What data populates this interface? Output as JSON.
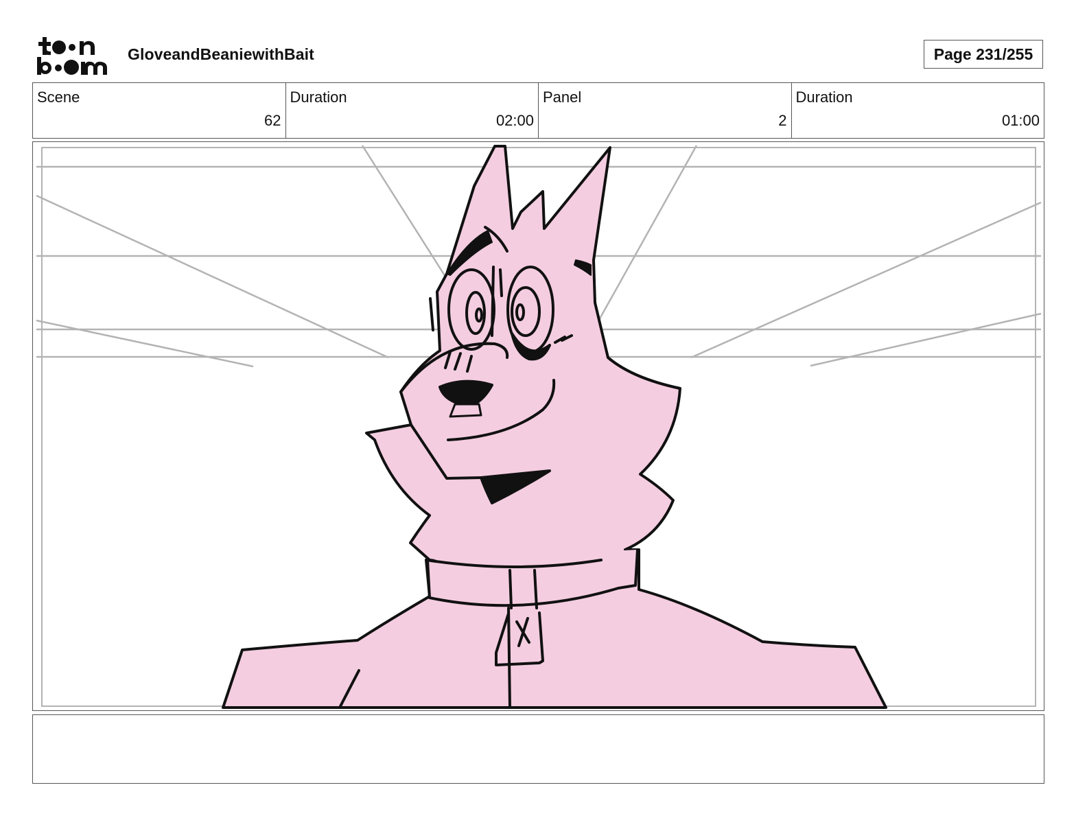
{
  "header": {
    "logo_text": "toon boom",
    "project_title": "GloveandBeaniewithBait",
    "page_label": "Page 231/255"
  },
  "info": {
    "scene_label": "Scene",
    "scene_value": "62",
    "scene_duration_label": "Duration",
    "scene_duration_value": "02:00",
    "panel_label": "Panel",
    "panel_value": "2",
    "panel_duration_label": "Duration",
    "panel_duration_value": "01:00"
  },
  "panel": {
    "illustration": "pink-wolf-character",
    "fill_color": "#f4cde0",
    "line_color": "#111111",
    "guide_color": "#b3b3b3"
  },
  "notes": {
    "text": ""
  }
}
